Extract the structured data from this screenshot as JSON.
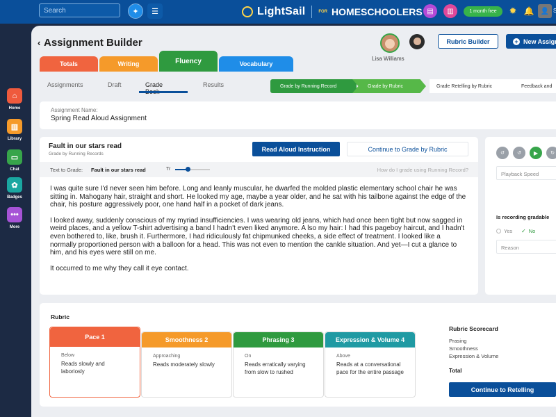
{
  "topbar": {
    "search_placeholder": "Search",
    "logo_text": "LightSail",
    "logo_for": "FOR",
    "logo_homeschoolers": "HOMESCHOOLERS",
    "free_badge": "1 month free",
    "user_initials": "Sa"
  },
  "sidebar": {
    "items": [
      {
        "label": "Home",
        "color": "#ef5a3d"
      },
      {
        "label": "Library",
        "color": "#f59a2a"
      },
      {
        "label": "Chat",
        "color": "#37a54a"
      },
      {
        "label": "Badges",
        "color": "#1aa7a1"
      },
      {
        "label": "More",
        "color": "#a653d6"
      }
    ]
  },
  "header": {
    "title": "Assignment Builder",
    "user_name": "Lisa Williams",
    "rubric_builder": "Rubric Builder",
    "new_assignment": "New Assign"
  },
  "tabs": [
    {
      "label": "Totals",
      "color": "#f0643f"
    },
    {
      "label": "Writing",
      "color": "#f59a2a"
    },
    {
      "label": "Fluency",
      "color": "#2f9a3f"
    },
    {
      "label": "Vocabulary",
      "color": "#1f8de8"
    }
  ],
  "subtabs": [
    "Assignments",
    "Draft",
    "Grade Book",
    "Results"
  ],
  "steps": [
    "Grade by Running Record",
    "Grade by Rubric",
    "Grade Retelling by Rubric",
    "Feedback and"
  ],
  "assignment": {
    "name_label": "Assignment Name:",
    "name": "Spring Read Aloud Assignment"
  },
  "reading": {
    "title": "Fault in our stars read",
    "subtitle": "Grade by Running Records",
    "read_aloud_btn": "Read Aloud Instruction",
    "continue_btn": "Continue to Grade by Rubric",
    "text_to_grade_label": "Text to Grade:",
    "text_to_grade_value": "Fault in our stars read",
    "font_icon_label": "Tr",
    "help_link": "How do I grade using Running Record?",
    "paragraphs": [
      "I was quite sure I'd never seen him before. Long and leanly muscular, he dwarfed the molded plastic elementary school chair he was sitting in. Mahogany hair, straight and short. He looked my age, maybe a year older, and he sat with his tailbone against the edge of the chair, his posture aggressively poor, one hand half in a pocket of dark jeans.",
      "I looked away, suddenly conscious of my myriad insufficiencies. I was wearing old jeans, which had once been tight but now sagged in weird places, and a yellow T-shirt advertising a band I hadn't even liked anymore. A lso my hair: I had this pageboy haircut, and I hadn't even bothered to, like, brush it. Furthermore, I had ridiculously fat chipmunked cheeks, a side effect of treatment. I looked like a normally proportioned person with a balloon for a head. This was not even to mention the cankle situation. And yet—I cut a glance to him, and his eyes were still on me.",
      "It occurred to me why they call it eye contact."
    ]
  },
  "playback": {
    "speed_label": "Playback Speed",
    "gradable_question": "Is recording gradable",
    "yes": "Yes",
    "no": "No",
    "reason_placeholder": "Reason"
  },
  "rubric": {
    "title": "Rubric",
    "columns": [
      {
        "header": "Pace 1",
        "level": "Below",
        "text": "Reads slowly and laboriosly",
        "color": "#f0643f"
      },
      {
        "header": "Smoothness 2",
        "level": "Approaching",
        "text": "Reads moderately slowly",
        "color": "#f59a2a"
      },
      {
        "header": "Phrasing 3",
        "level": "On",
        "text": "Reads erratically varying from slow to rushed",
        "color": "#2f9a3f"
      },
      {
        "header": "Expression & Volume 4",
        "level": "Above",
        "text": "Reads at a conversational pace for the entire passage",
        "color": "#1f9aa3"
      }
    ],
    "scorecard_title": "Rubric Scorecard",
    "scorecard_items": [
      "Prasing",
      "Smoothness",
      "Expression & Volume"
    ],
    "total_label": "Total",
    "continue_retelling": "Continue to Retelling"
  }
}
